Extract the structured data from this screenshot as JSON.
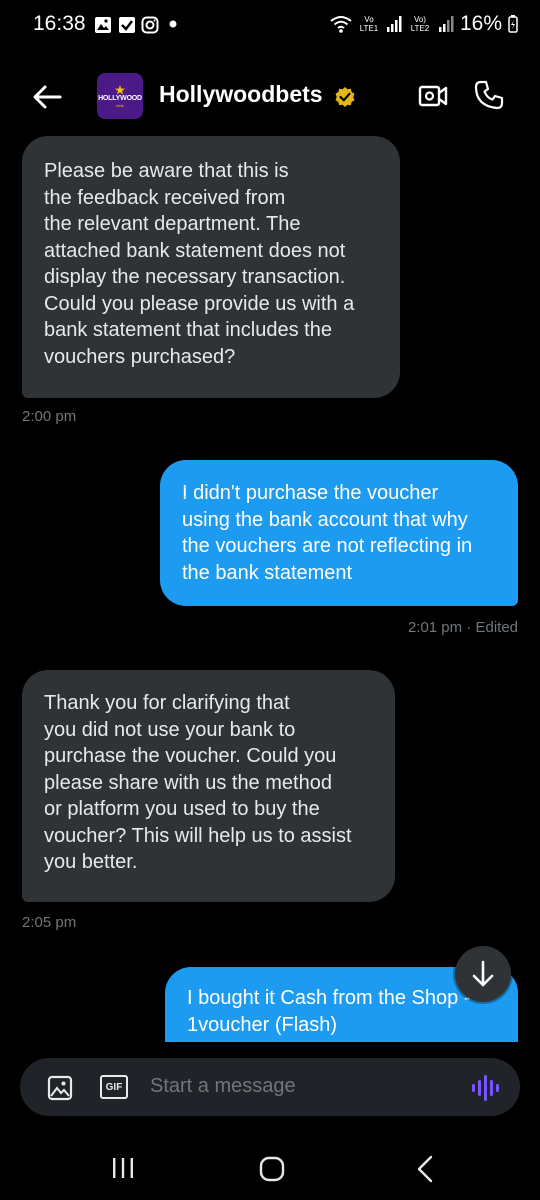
{
  "status_bar": {
    "time": "16:38",
    "battery": "16%",
    "network_1": "Vo LTE1",
    "network_2": "Vo) LTE2"
  },
  "header": {
    "contact_name": "Hollywoodbets",
    "avatar_text": "HOLLYWOOD",
    "avatar_subtext": "bets",
    "verified_color": "#e2b719"
  },
  "messages": [
    {
      "direction": "incoming",
      "text": "Please be aware that this is\nthe feedback received from\nthe relevant department. The\nattached bank statement does not\ndisplay the necessary transaction.\nCould you please provide us with a\nbank statement that includes the\nvouchers purchased?",
      "meta": "2:00 pm"
    },
    {
      "direction": "outgoing",
      "text": "I didn't  purchase the voucher\nusing the bank account that why\nthe vouchers are not reflecting in\nthe bank statement",
      "meta": "2:01 pm · Edited"
    },
    {
      "direction": "incoming",
      "text": "Thank you for clarifying that\nyou did not use your bank to\npurchase the voucher. Could you\nplease share with us the method\nor platform you used to buy the\nvoucher? This will help us to assist\nyou better.",
      "meta": "2:05 pm"
    },
    {
      "direction": "outgoing",
      "text": "I bought it Cash from the Shop -\n1voucher  (Flash)",
      "meta": ""
    }
  ],
  "composer": {
    "placeholder": "Start a message",
    "gif_label": "GIF"
  },
  "colors": {
    "incoming_bubble": "#2f3336",
    "outgoing_bubble": "#1d9bf0",
    "accent_voice": "#7856ff",
    "brand_purple": "#4b1a86"
  }
}
